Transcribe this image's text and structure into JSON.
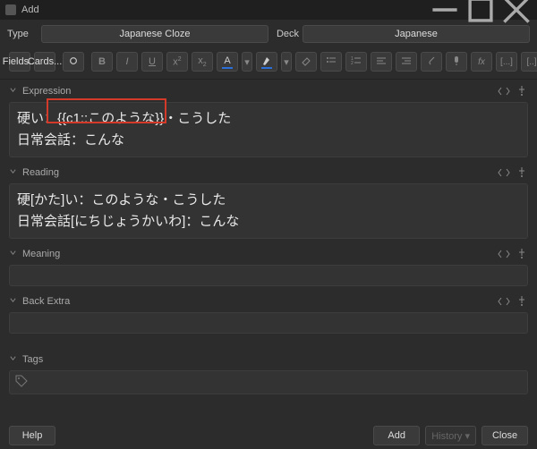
{
  "window": {
    "title": "Add"
  },
  "selectors": {
    "type_label": "Type",
    "type_value": "Japanese Cloze",
    "deck_label": "Deck",
    "deck_value": "Japanese"
  },
  "toolbar": {
    "fields_label": "Fields...",
    "cards_label": "Cards...",
    "format_labels": {
      "bold": "B",
      "italic": "I",
      "underline": "U"
    }
  },
  "fields": [
    {
      "name": "Expression",
      "content": "硬い：{{c1::このような}}・こうした\n日常会話：こんな"
    },
    {
      "name": "Reading",
      "content": "硬[かた]い：このような・こうした\n日常会話[にちじょうかいわ]：こんな"
    },
    {
      "name": "Meaning",
      "content": ""
    },
    {
      "name": "Back Extra",
      "content": ""
    }
  ],
  "tags": {
    "label": "Tags"
  },
  "bottom": {
    "help": "Help",
    "add": "Add",
    "history": "History ▾",
    "close": "Close"
  }
}
